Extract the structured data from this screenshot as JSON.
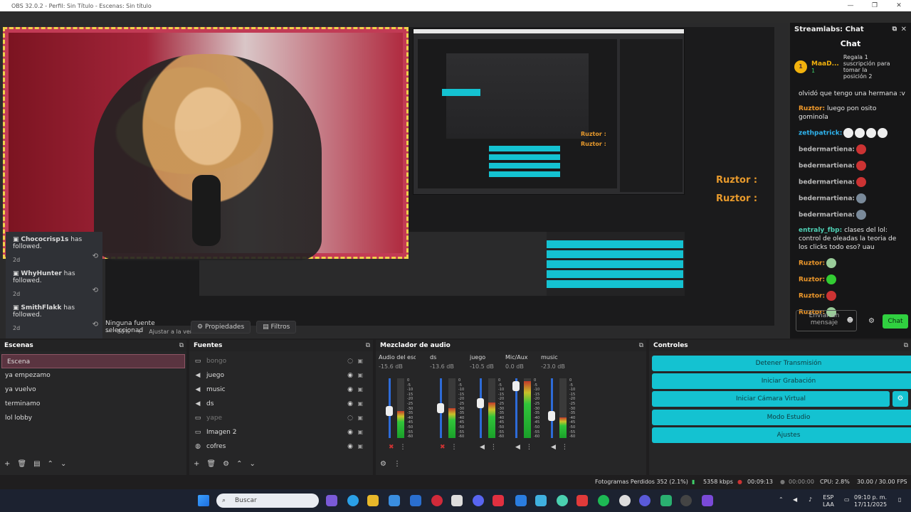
{
  "window": {
    "title": "OBS 32.0.2 - Perfil: Sin Título - Escenas: Sin título",
    "controls": [
      "—",
      "❐",
      "✕"
    ]
  },
  "preview": {
    "nested_ruztor_1": "Ruztor :",
    "nested_ruztor_2": "Ruztor :",
    "ruztor_large_1": "Ruztor :",
    "ruztor_large_2": "Ruztor :",
    "zoom": "80%",
    "fit_label": "Ajustar a la ventana"
  },
  "followers": [
    {
      "name": "Chococrisp1s",
      "text": "has followed.",
      "time": "2d"
    },
    {
      "name": "WhyHunter",
      "text": "has followed.",
      "time": "2d"
    },
    {
      "name": "SmithFlakk",
      "text": "has followed.",
      "time": "2d"
    }
  ],
  "chat": {
    "dock_title": "Streamlabs: Chat",
    "title": "Chat",
    "pinned_user": "MaaD...",
    "pinned_count": "1",
    "pinned_text": "Regala 1 suscripción para tomar la posición 2",
    "messages": [
      {
        "user": "",
        "text": "olvidó que tengo una hermana :v"
      },
      {
        "user": "Ruztor:",
        "text": "luego pon osito gominola"
      },
      {
        "user": "zethpatrick:",
        "text": ""
      },
      {
        "user": "bedermartiena:",
        "text": ""
      },
      {
        "user": "bedermartiena:",
        "text": ""
      },
      {
        "user": "bedermartiena:",
        "text": ""
      },
      {
        "user": "bedermartiena:",
        "text": ""
      },
      {
        "user": "bedermartiena:",
        "text": ""
      },
      {
        "user": "entraly_fbp:",
        "text": "clases del lol: control de oleadas la teoria de los clicks todo eso? uau"
      },
      {
        "user": "Ruztor:",
        "text": ""
      },
      {
        "user": "Ruztor:",
        "text": ""
      },
      {
        "user": "Ruztor:",
        "text": ""
      },
      {
        "user": "Ruztor:",
        "text": ""
      }
    ],
    "input_placeholder": "Enviar un mensaje",
    "send_label": "Chat"
  },
  "source_bar": {
    "none_selected": "Ninguna fuente seleccionad",
    "properties": "Propiedades",
    "filters": "Filtros"
  },
  "scenes": {
    "title": "Escenas",
    "items": [
      "Escena",
      "ya empezamo",
      "ya vuelvo",
      "terminamo",
      "lol lobby"
    ]
  },
  "sources": {
    "title": "Fuentes",
    "items": [
      {
        "name": "bongo",
        "icon": "image-icon",
        "dim": true
      },
      {
        "name": "juego",
        "icon": "speaker-icon",
        "dim": false
      },
      {
        "name": "music",
        "icon": "speaker-icon",
        "dim": false
      },
      {
        "name": "ds",
        "icon": "speaker-icon",
        "dim": false
      },
      {
        "name": "yape",
        "icon": "image-icon",
        "dim": true
      },
      {
        "name": "Imagen 2",
        "icon": "image-icon",
        "dim": false
      },
      {
        "name": "cofres",
        "icon": "browser-icon",
        "dim": false
      }
    ]
  },
  "mixer": {
    "title": "Mezclador de audio",
    "channels": [
      {
        "name": "Audio del escritorio",
        "db": "-15.6 dB",
        "level": 0.45,
        "muted": true
      },
      {
        "name": "ds",
        "db": "-13.6 dB",
        "level": 0.5,
        "muted": true
      },
      {
        "name": "juego",
        "db": "-10.5 dB",
        "level": 0.6,
        "muted": false
      },
      {
        "name": "Mic/Aux",
        "db": "0.0 dB",
        "level": 0.95,
        "muted": false
      },
      {
        "name": "music",
        "db": "-23.0 dB",
        "level": 0.35,
        "muted": false
      }
    ],
    "scale": [
      "0",
      "-5",
      "-10",
      "-15",
      "-20",
      "-25",
      "-30",
      "-35",
      "-40",
      "-45",
      "-50",
      "-55",
      "-60"
    ]
  },
  "controls": {
    "title": "Controles",
    "stop_stream": "Detener Transmisión",
    "start_recording": "Iniciar Grabación",
    "virtual_camera": "Iniciar Cámara Virtual",
    "studio_mode": "Modo Estudio",
    "settings": "Ajustes"
  },
  "status": {
    "dropped_frames": "Fotogramas Perdidos 352 (2.1%)",
    "bitrate": "5358 kbps",
    "stream_time": "00:09:13",
    "rec_time": "00:00:00",
    "cpu": "CPU: 2.8%",
    "fps": "30.00 / 30.00 FPS"
  },
  "taskbar": {
    "search_placeholder": "Buscar",
    "lang": "ESP",
    "lang2": "LAA",
    "time": "09:10 p. m.",
    "date": "17/11/2025"
  }
}
